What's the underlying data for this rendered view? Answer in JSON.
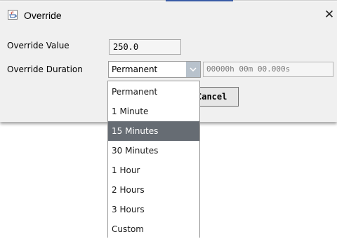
{
  "dialog": {
    "title": "Override",
    "close_glyph": "✕",
    "icon": "java-app-icon"
  },
  "form": {
    "value_label": "Override Value",
    "value": "250.0",
    "duration_label": "Override Duration",
    "duration_selected": "Permanent",
    "duration_text": "00000h 00m 00.000s",
    "cancel_label": "Cancel",
    "cancel_visible_text": "ancel"
  },
  "dropdown": {
    "options": [
      "Permanent",
      "1 Minute",
      "15 Minutes",
      "30 Minutes",
      "1 Hour",
      "2 Hours",
      "3 Hours",
      "Custom"
    ],
    "highlighted": "15 Minutes"
  },
  "colors": {
    "highlight": "#666c73",
    "dialog_bg": "#f0f0f0",
    "arrow_button": "#b8c2cc"
  }
}
